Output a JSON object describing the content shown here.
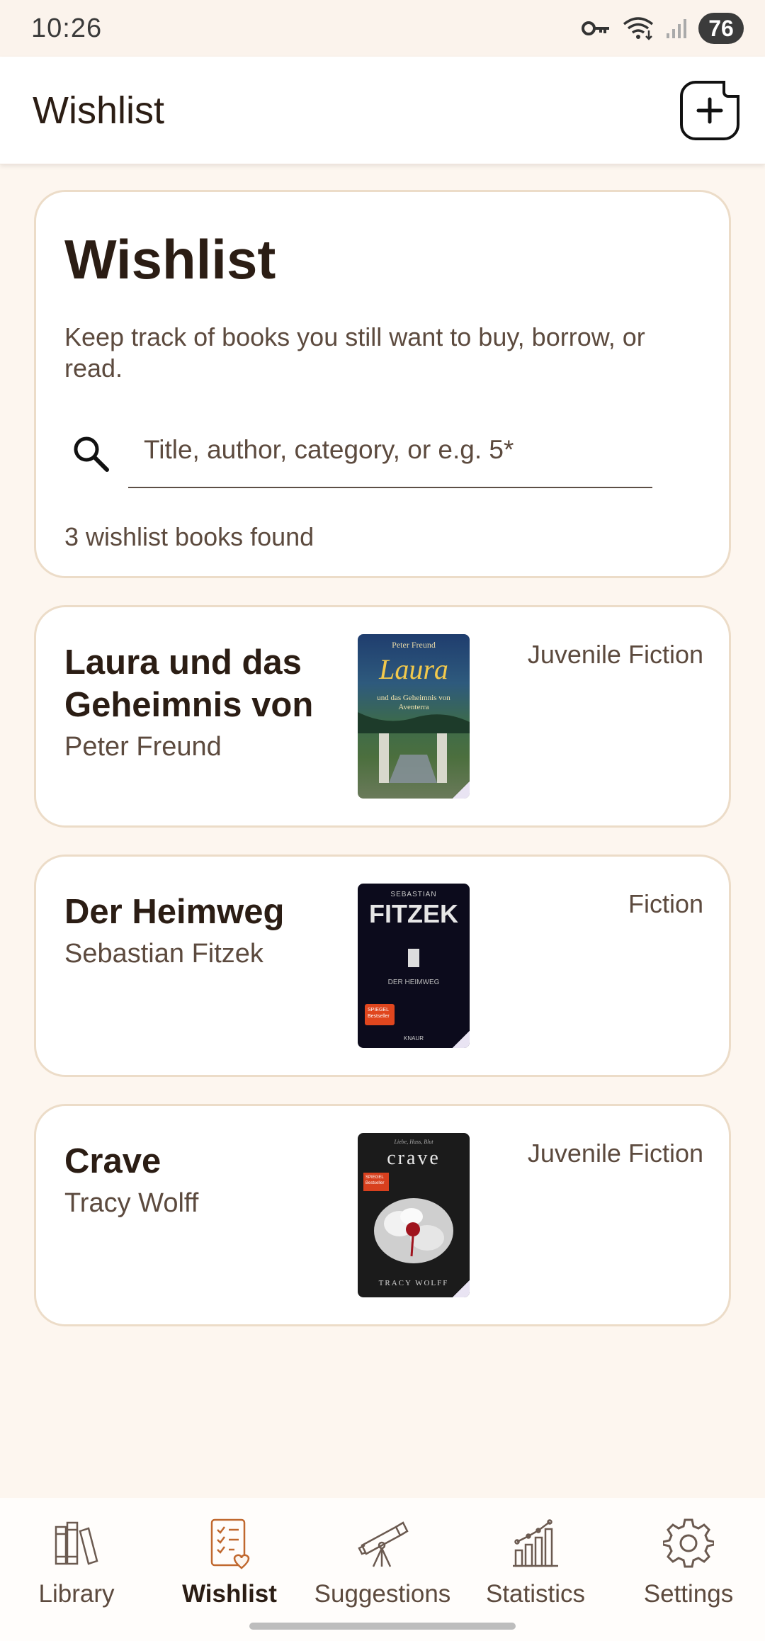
{
  "status_bar": {
    "time": "10:26",
    "battery": "76"
  },
  "app_bar": {
    "title": "Wishlist",
    "add_icon": "add-note-icon"
  },
  "header": {
    "title": "Wishlist",
    "description": "Keep track of books you still want to buy, borrow, or read.",
    "search_placeholder": "Title, author, category, or e.g. 5*",
    "result_count": "3 wishlist books found"
  },
  "books": [
    {
      "title": "Laura und das Geheimnis von",
      "author": "Peter Freund",
      "category": "Juvenile Fiction",
      "cover": {
        "top": "Peter Freund",
        "main": "Laura",
        "sub": "und das Geheimnis von Aventerra"
      }
    },
    {
      "title": "Der Heimweg",
      "author": "Sebastian Fitzek",
      "category": "Fiction",
      "cover": {
        "top": "SEBASTIAN",
        "main": "FITZEK",
        "sub": "DER HEIMWEG",
        "badge": "SPIEGEL Bestseller",
        "publisher": "KNAUR"
      }
    },
    {
      "title": "Crave",
      "author": "Tracy Wolff",
      "category": "Juvenile Fiction",
      "cover": {
        "top": "Liebe, Hass, Blut",
        "main": "crave",
        "badge": "SPIEGEL Bestseller",
        "sub": "TRACY WOLFF"
      }
    }
  ],
  "nav": {
    "items": [
      {
        "label": "Library",
        "icon": "books-icon"
      },
      {
        "label": "Wishlist",
        "icon": "wishlist-icon"
      },
      {
        "label": "Suggestions",
        "icon": "telescope-icon"
      },
      {
        "label": "Statistics",
        "icon": "chart-icon"
      },
      {
        "label": "Settings",
        "icon": "gear-icon"
      }
    ],
    "active": "Wishlist"
  },
  "colors": {
    "background": "#fdf6ef",
    "accent": "#c0682e",
    "text": "#2b1d14",
    "card_border": "#ecdcc8"
  }
}
